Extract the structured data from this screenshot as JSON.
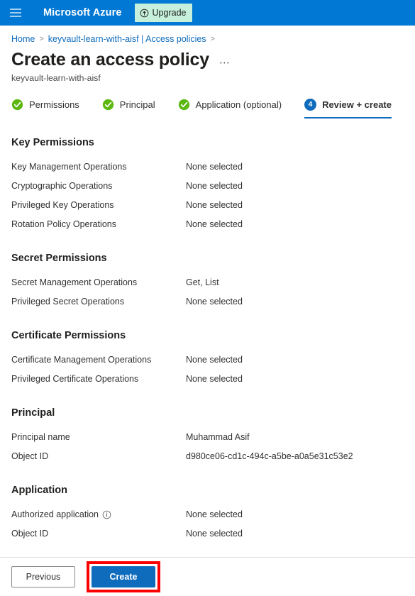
{
  "topbar": {
    "menu_icon": "hamburger-icon",
    "brand": "Microsoft Azure",
    "upgrade_label": "Upgrade",
    "upgrade_icon": "arrow-up-circle-icon",
    "bar_color": "#0078d4",
    "upgrade_bg": "#c6f0dc"
  },
  "breadcrumb": {
    "items": [
      {
        "label": "Home"
      },
      {
        "label": "keyvault-learn-with-aisf | Access policies"
      }
    ],
    "separator": ">",
    "link_color": "#0f6cbd"
  },
  "header": {
    "title": "Create an access policy",
    "overflow_label": "⋯",
    "subtitle": "keyvault-learn-with-aisf"
  },
  "steps": [
    {
      "label": "Permissions",
      "state": "complete",
      "icon": "check-circle-icon"
    },
    {
      "label": "Principal",
      "state": "complete",
      "icon": "check-circle-icon"
    },
    {
      "label": "Application (optional)",
      "state": "complete",
      "icon": "check-circle-icon"
    },
    {
      "label": "Review + create",
      "state": "active",
      "number": "4"
    }
  ],
  "step_colors": {
    "complete": "#5cb811",
    "active": "#0f6cbd"
  },
  "sections": [
    {
      "heading": "Key Permissions",
      "rows": [
        {
          "key": "Key Management Operations",
          "value": "None selected"
        },
        {
          "key": "Cryptographic Operations",
          "value": "None selected"
        },
        {
          "key": "Privileged Key Operations",
          "value": "None selected"
        },
        {
          "key": "Rotation Policy Operations",
          "value": "None selected"
        }
      ]
    },
    {
      "heading": "Secret Permissions",
      "rows": [
        {
          "key": "Secret Management Operations",
          "value": "Get, List"
        },
        {
          "key": "Privileged Secret Operations",
          "value": "None selected"
        }
      ]
    },
    {
      "heading": "Certificate Permissions",
      "rows": [
        {
          "key": "Certificate Management Operations",
          "value": "None selected"
        },
        {
          "key": "Privileged Certificate Operations",
          "value": "None selected"
        }
      ]
    },
    {
      "heading": "Principal",
      "rows": [
        {
          "key": "Principal name",
          "value": "Muhammad Asif"
        },
        {
          "key": "Object ID",
          "value": "d980ce06-cd1c-494c-a5be-a0a5e31c53e2"
        }
      ]
    },
    {
      "heading": "Application",
      "rows": [
        {
          "key": "Authorized application",
          "value": "None selected",
          "info": true
        },
        {
          "key": "Object ID",
          "value": "None selected"
        }
      ]
    }
  ],
  "footer": {
    "previous_label": "Previous",
    "create_label": "Create",
    "highlight_color": "#ff0000",
    "primary_color": "#0f6cbd"
  }
}
